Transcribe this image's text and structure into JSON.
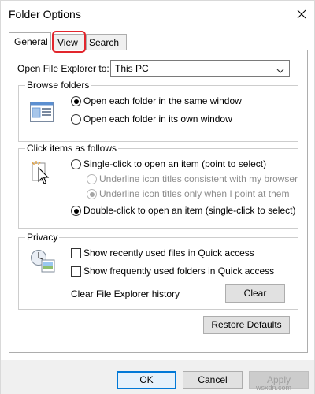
{
  "window": {
    "title": "Folder Options",
    "close_icon": "close-icon"
  },
  "tabs": [
    {
      "label": "General",
      "active": true
    },
    {
      "label": "View",
      "active": false,
      "highlighted": true
    },
    {
      "label": "Search",
      "active": false
    }
  ],
  "highlight_color": "#e2262d",
  "general": {
    "open_explorer_label": "Open File Explorer to:",
    "open_explorer_value": "This PC",
    "browse_folders": {
      "title": "Browse folders",
      "icon": "browse-folders-icon",
      "options": [
        {
          "label": "Open each folder in the same window",
          "checked": true
        },
        {
          "label": "Open each folder in its own window",
          "checked": false
        }
      ]
    },
    "click_items": {
      "title": "Click items as follows",
      "icon": "pointer-click-icon",
      "options": [
        {
          "label": "Single-click to open an item (point to select)",
          "checked": false,
          "disabled": false
        },
        {
          "label": "Underline icon titles consistent with my browser",
          "checked": false,
          "disabled": true
        },
        {
          "label": "Underline icon titles only when I point at them",
          "checked": true,
          "disabled": true
        },
        {
          "label": "Double-click to open an item (single-click to select)",
          "checked": true,
          "disabled": false
        }
      ]
    },
    "privacy": {
      "title": "Privacy",
      "icon": "privacy-icon",
      "checkboxes": [
        {
          "label": "Show recently used files in Quick access",
          "checked": false
        },
        {
          "label": "Show frequently used folders in Quick access",
          "checked": false
        }
      ],
      "clear_label": "Clear File Explorer history",
      "clear_button": "Clear"
    },
    "restore_defaults_button": "Restore Defaults"
  },
  "footer": {
    "ok_button": "OK",
    "cancel_button": "Cancel",
    "apply_button": "Apply",
    "accent_color": "#0078d7"
  },
  "watermark": "wsxdn.com"
}
